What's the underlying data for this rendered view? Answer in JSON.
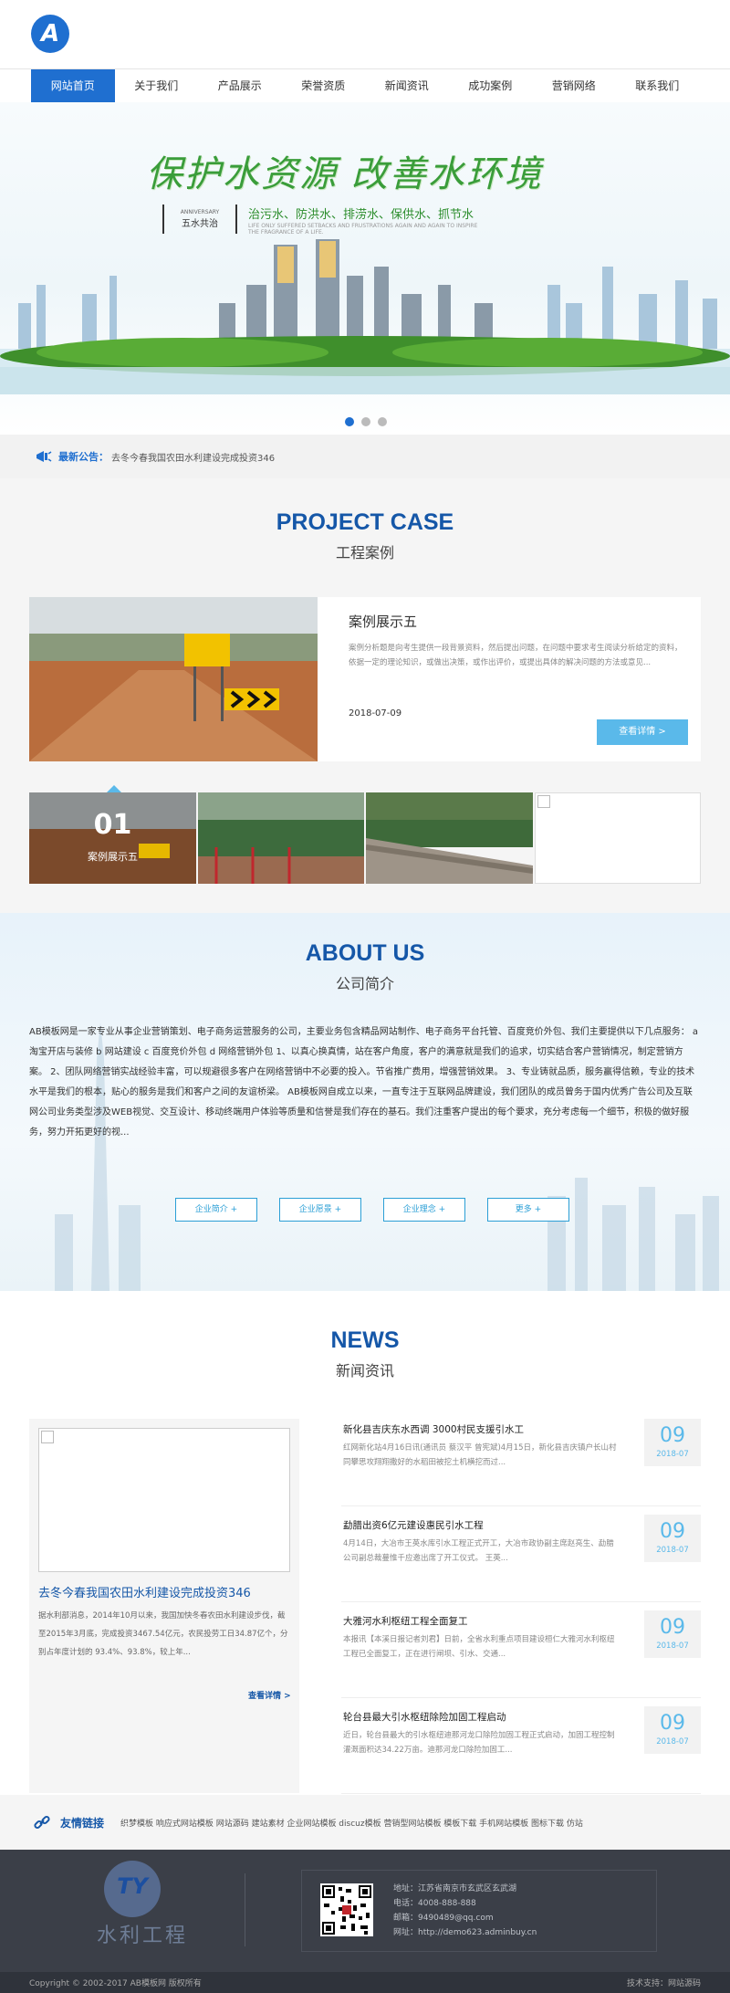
{
  "header": {
    "logo_letter": "A",
    "nav": [
      {
        "label": "网站首页",
        "active": true
      },
      {
        "label": "关于我们"
      },
      {
        "label": "产品展示"
      },
      {
        "label": "荣誉资质"
      },
      {
        "label": "新闻资讯"
      },
      {
        "label": "成功案例"
      },
      {
        "label": "营销网络"
      },
      {
        "label": "联系我们"
      }
    ]
  },
  "banner": {
    "slogan": "保护水资源  改善水环境",
    "anniversary_small": "ANNIVERSARY",
    "anniversary_main": "五水共治",
    "line1": "治污水、防洪水、排涝水、保供水、抓节水",
    "line2": "LIFE ONLY SUFFERED SETBACKS AND FRUSTRATIONS AGAIN AND AGAIN TO INSPIRE THE FRAGRANCE OF A LIFE.",
    "slides": 3,
    "active_slide": 0
  },
  "notice": {
    "label": "最新公告：",
    "text": "去冬今春我国农田水利建设完成投资346"
  },
  "project": {
    "title_en": "PROJECT CASE",
    "title_cn": "工程案例",
    "card": {
      "title": "案例展示五",
      "desc": "案例分析题是向考生提供一段背景资料，然后提出问题，在问题中要求考生阅读分析给定的资料，依据一定的理论知识，或做出决策，或作出评价，或提出具体的解决问题的方法或意见...",
      "date": "2018-07-09",
      "button": "查看详情 >"
    },
    "thumbs": [
      {
        "num": "01",
        "label": "案例展示五"
      },
      {
        "num": "",
        "label": ""
      },
      {
        "num": "",
        "label": ""
      },
      {
        "num": "",
        "label": ""
      }
    ]
  },
  "about": {
    "title_en": "ABOUT US",
    "title_cn": "公司简介",
    "text": "AB模板网是一家专业从事企业营销策划、电子商务运营服务的公司，主要业务包含精品网站制作、电子商务平台托管、百度竞价外包、我们主要提供以下几点服务： a 淘宝开店与装修 b 网站建设 c 百度竞价外包 d 网络营销外包 1、以真心换真情，站在客户角度，客户的满意就是我们的追求，切实结合客户营销情况，制定营销方案。 2、团队网络营销实战经验丰富，可以规避很多客户在网络营销中不必要的投入。节省推广费用，增强营销效果。 3、专业铸就品质，服务赢得信赖，专业的技术水平是我们的根本，贴心的服务是我们和客户之间的友谊桥梁。 AB模板网自成立以来，一直专注于互联网品牌建设，我们团队的成员曾务于国内优秀广告公司及互联网公司业务类型涉及WEB视觉、交互设计、移动终端用户体验等质量和信誉是我们存在的基石。我们注重客户提出的每个要求，充分考虑每一个细节，积极的做好服务，努力开拓更好的视...",
    "buttons": [
      "企业简介 +",
      "企业愿景 +",
      "企业理念 +",
      "更多 +"
    ]
  },
  "news": {
    "title_en": "NEWS",
    "title_cn": "新闻资讯",
    "featured": {
      "title": "去冬今春我国农田水利建设完成投资346",
      "desc": "据水利部消息，2014年10月以来，我国加快冬春农田水利建设步伐，截至2015年3月底，完成投资3467.54亿元，农民投劳工日34.87亿个，分别占年度计划的 93.4%、93.8%，较上年...",
      "more": "查看详情 >"
    },
    "items": [
      {
        "title": "新化县吉庆东水西调 3000村民支援引水工",
        "desc": "红网新化站4月16日讯(通讯员 蔡汉平 曾宪斌)4月15日，新化县吉庆镇户长山村同攀思攻翔翔撒好的水稻田被挖土机横挖而过...",
        "day": "09",
        "ym": "2018-07"
      },
      {
        "title": "勐腊出资6亿元建设惠民引水工程",
        "desc": "4月14日，大冶市王英水库引水工程正式开工，大冶市政协副主席赵亮生、勐腊公司副总裁蔓惟千应邀出席了开工仪式。 王英...",
        "day": "09",
        "ym": "2018-07"
      },
      {
        "title": "大雅河水利枢纽工程全面复工",
        "desc": "本报讯【本溪日报记者刘君】日前，全省水利重点项目建设桓仁大雅河水利枢纽工程已全面复工，正在进行闸坝、引水、交通...",
        "day": "09",
        "ym": "2018-07"
      },
      {
        "title": "轮台县最大引水枢纽除险加固工程启动",
        "desc": "近日，轮台县最大的引水枢纽迪那河龙口除险加固工程正式启动，加固工程控制灌溉面积达34.22万亩。迪那河龙口除险加固工...",
        "day": "09",
        "ym": "2018-07"
      }
    ]
  },
  "links": {
    "label": "友情链接",
    "list": "织梦模板 响应式网站模板 网站源码 建站素材 企业网站模板 discuz模板 营销型网站模板 模板下载 手机网站模板 图标下载 仿站"
  },
  "footer": {
    "logo_letters": "TY",
    "logo_text": "水利工程",
    "info": [
      "地址：江苏省南京市玄武区玄武湖",
      "电话：4008-888-888",
      "邮箱：9490489@qq.com",
      "网址：http://demo623.adminbuy.cn"
    ],
    "copyright": "Copyright © 2002-2017 AB模板网 版权所有",
    "support": "技术支持：网站源码"
  }
}
